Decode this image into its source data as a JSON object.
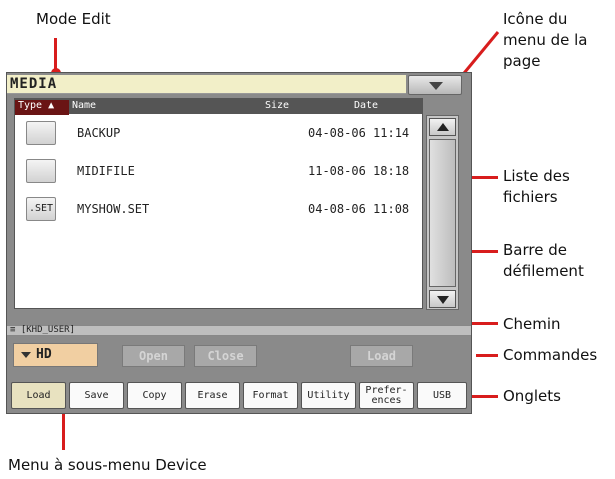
{
  "annotations": {
    "mode_edit": "Mode Edit",
    "menu_icon": [
      "Icône du",
      "menu de la",
      "page"
    ],
    "file_list": [
      "Liste des",
      "fichiers"
    ],
    "scrollbar": [
      "Barre de",
      "défilement"
    ],
    "path": "Chemin",
    "commands": "Commandes",
    "tabs": "Onglets",
    "device_menu": "Menu à sous-menu Device"
  },
  "screen": {
    "title": "MEDIA",
    "columns": {
      "type": "Type ▲",
      "name": "Name",
      "size": "Size",
      "date": "Date"
    },
    "files": [
      {
        "icon_label": "",
        "name": "BACKUP",
        "date": "04-08-06 11:14"
      },
      {
        "icon_label": "",
        "name": "MIDIFILE",
        "date": "11-08-06 18:18"
      },
      {
        "icon_label": ".SET",
        "name": "MYSHOW.SET",
        "date": "04-08-06 11:08"
      }
    ],
    "path": "≡ [KHD_USER]",
    "device": "HD",
    "commands": {
      "open": "Open",
      "close": "Close",
      "load": "Load"
    },
    "tabs": [
      "Load",
      "Save",
      "Copy",
      "Erase",
      "Format",
      "Utility",
      "Prefer-\nences",
      "USB"
    ]
  },
  "colors": {
    "annotation_line": "#d81d1d",
    "title_bar": "#f2efc8",
    "device_button": "#f1cfa2",
    "panel": "#8a8a8a"
  }
}
